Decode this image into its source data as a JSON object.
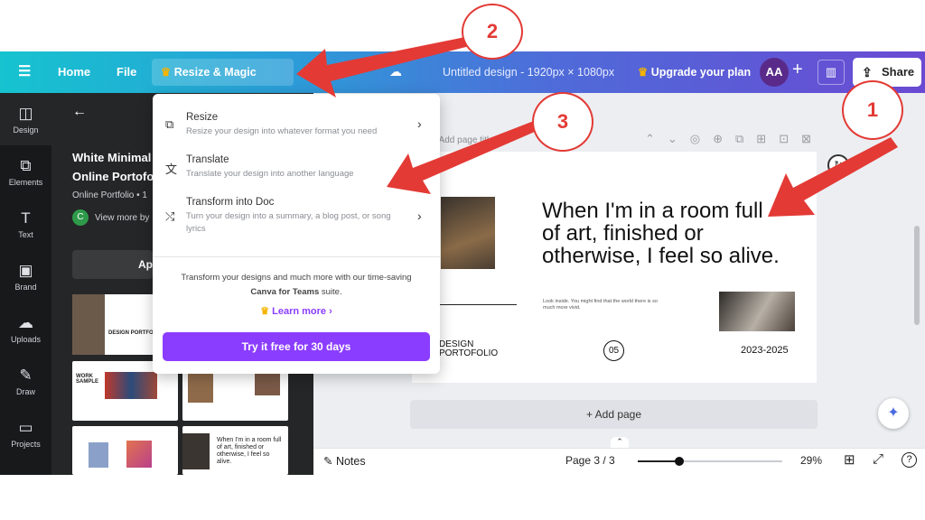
{
  "topbar": {
    "home": "Home",
    "file": "File",
    "magic_switch": "Resize & Magic Switch",
    "doc_title": "Untitled design - 1920px × 1080px",
    "upgrade": "Upgrade your plan",
    "avatar": "AA",
    "share": "Share"
  },
  "sidebar": {
    "items": [
      {
        "label": "Design",
        "icon": "design-icon"
      },
      {
        "label": "Elements",
        "icon": "elements-icon"
      },
      {
        "label": "Text",
        "icon": "text-icon"
      },
      {
        "label": "Brand",
        "icon": "brand-icon"
      },
      {
        "label": "Uploads",
        "icon": "uploads-icon"
      },
      {
        "label": "Draw",
        "icon": "draw-icon"
      },
      {
        "label": "Projects",
        "icon": "projects-icon"
      }
    ]
  },
  "panel": {
    "title_line1": "White Minimal",
    "title_line2": "Online Portofo",
    "subtitle": "Online Portfolio • 1",
    "creator_initial": "C",
    "view_more": "View more by",
    "apply": "Ap"
  },
  "dropdown": {
    "items": [
      {
        "title": "Resize",
        "desc": "Resize your design into whatever format you need"
      },
      {
        "title": "Translate",
        "desc": "Translate your design into another language"
      },
      {
        "title": "Transform into Doc",
        "desc": "Turn your design into a summary, a blog post, or song lyrics"
      }
    ],
    "promo_line1": "Transform your designs and much more with our time-saving",
    "promo_brand": "Canva for Teams",
    "promo_suffix": " suite.",
    "learn_more": "Learn more",
    "cta": "Try it free for 30 days"
  },
  "design": {
    "quote": "When I'm in a room full of art, finished or otherwise, I feel so alive.",
    "body": "Look inside. You might find that the world there is so much more vivid.",
    "brand_line1": "DESIGN",
    "brand_line2": "PORTOFOLIO",
    "page_num": "05",
    "years": "2023-2025",
    "page_title": "- Add page title"
  },
  "canvas": {
    "add_page": "+ Add page"
  },
  "bottombar": {
    "notes": "Notes",
    "page": "Page 3 / 3",
    "zoom": "29%",
    "zoom_level": 0.29
  },
  "annotations": {
    "n1": "1",
    "n2": "2",
    "n3": "3"
  },
  "thumbs": {
    "t1": "DESIGN PORTFOLIO 2023-",
    "t2": "WORK SAMPLE",
    "t3": "When I'm in a room full of art, finished or otherwise, I feel so alive."
  },
  "colors": {
    "accent": "#8b3dff",
    "annotation": "#e33a35",
    "crown": "#f5b400"
  }
}
